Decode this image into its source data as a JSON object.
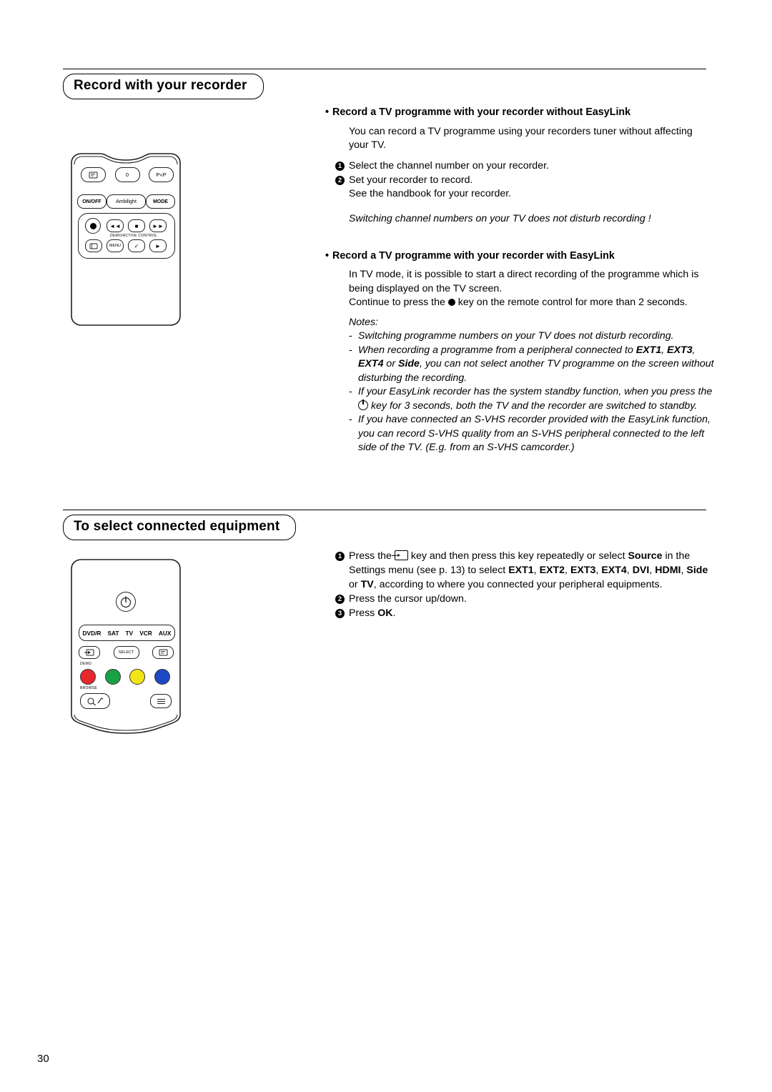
{
  "page": {
    "number": "30"
  },
  "sections": [
    {
      "title": "Record with your recorder",
      "blocks": {
        "sub1_title": "Record a TV programme with your recorder without EasyLink",
        "sub1_para": "You can record a TV programme using your recorders tuner without affecting your TV.",
        "sub1_step1": "Select the channel number on your recorder.",
        "sub1_step2_line1": "Set your recorder to record.",
        "sub1_step2_line2": "See the handbook for your recorder.",
        "sub1_italic": "Switching channel numbers on your TV does not disturb recording !",
        "sub2_title": "Record a TV programme with your recorder with EasyLink",
        "sub2_para1": "In TV mode, it is possible to start a direct recording of the programme which is being displayed on the TV screen.",
        "sub2_para2_a": "Continue to press the",
        "sub2_para2_b": "key on the remote control for more than 2 seconds.",
        "notes_label": "Notes:",
        "note1": "Switching programme numbers on your TV does not disturb recording.",
        "note2_a": "When recording a programme from a peripheral connected to ",
        "note2_b": "EXT1",
        "note2_c": ", ",
        "note2_d": "EXT3",
        "note2_e": ", ",
        "note2_f": "EXT4",
        "note2_g": " or ",
        "note2_h": "Side",
        "note2_i": ", you can not select another TV programme on the screen without disturbing the recording.",
        "note3_a": "If your EasyLink recorder has the system standby function, when you press the",
        "note3_b": "key for 3 seconds, both the TV and the recorder are switched to standby.",
        "note4": "If you have connected an S-VHS recorder provided with the EasyLink function, you can record S-VHS quality from an S-VHS peripheral connected to the left side of the TV. (E.g. from an S-VHS camcorder.)"
      }
    },
    {
      "title": "To select connected equipment",
      "blocks": {
        "step1_a": "Press the",
        "step1_b": "key and then press this key repeatedly or select ",
        "step1_source": "Source",
        "step1_c": " in the Settings menu (see p. 13) to select ",
        "step1_ext1": "EXT1",
        "step1_ext2": "EXT2",
        "step1_ext3": "EXT3",
        "step1_ext4": "EXT4",
        "step1_dvi": "DVI",
        "step1_hdmi": "HDMI",
        "step1_side": "Side",
        "step1_tv": "TV",
        "step1_or": " or ",
        "step1_d": ", according to where you connected your peripheral equipments.",
        "step2": "Press the cursor up/down.",
        "step3_a": "Press ",
        "step3_b": "OK",
        "step3_c": "."
      }
    }
  ],
  "remote1": {
    "keys_row1": [
      "⊞",
      "0",
      "P«P"
    ],
    "keys_row2": [
      "ON/OFF",
      "Ambilight",
      "MODE"
    ],
    "center_label": "DEMO/ACTIVE CONTROL",
    "keys_block_top": [
      "●",
      "◄◄",
      "■",
      "►►"
    ],
    "keys_block_bottom": [
      "[⊡]",
      "MENU",
      "✓",
      "►"
    ]
  },
  "remote2": {
    "modes": [
      "DVD/R",
      "SAT",
      "TV",
      "VCR",
      "AUX"
    ],
    "select_label": "SELECT",
    "demo_label": "DEMO",
    "browse_label": "BROWSE"
  },
  "colors": {
    "red": "#e8272c",
    "green": "#19a245",
    "yellow": "#f2e416",
    "blue": "#1c49c4"
  }
}
